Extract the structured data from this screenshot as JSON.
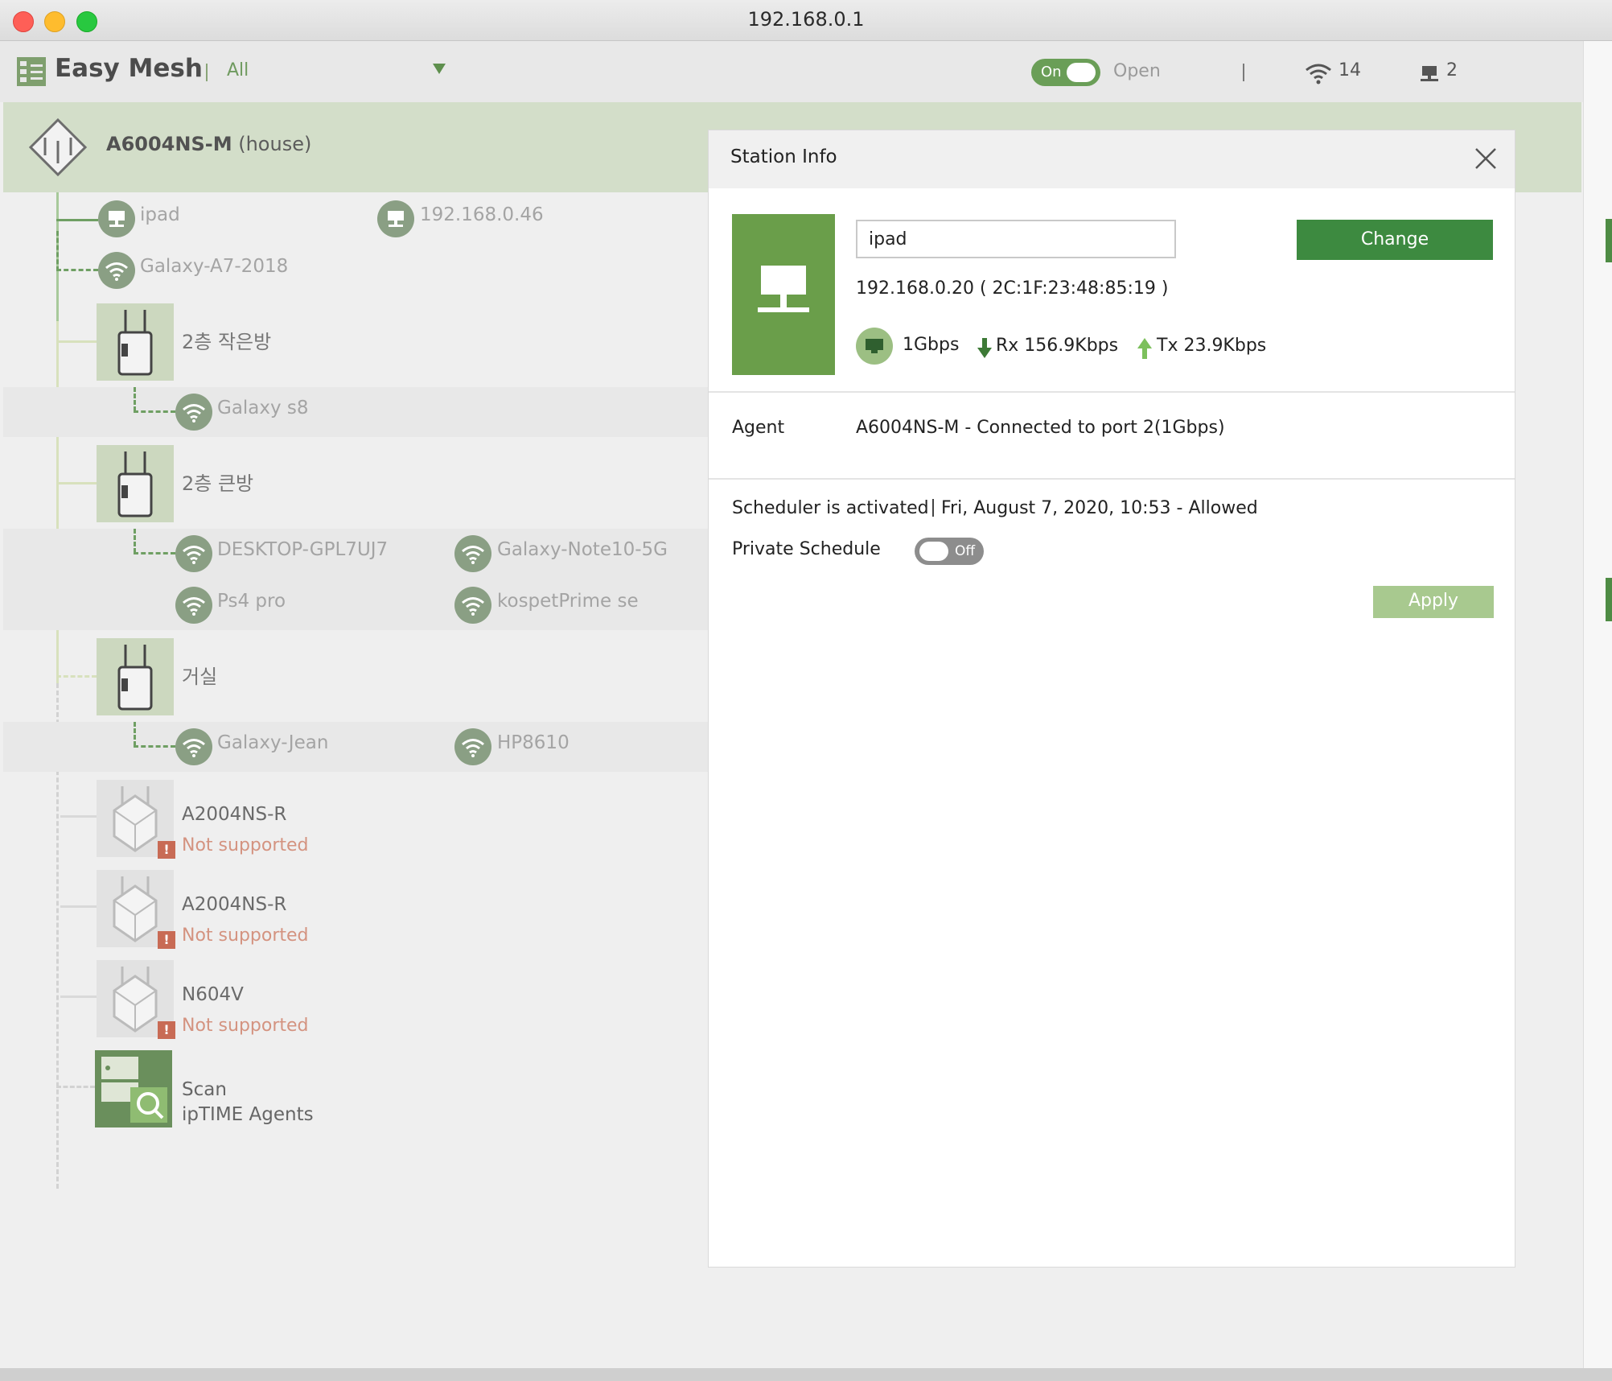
{
  "window": {
    "title": "192.168.0.1"
  },
  "appbar": {
    "app_name": "Easy Mesh",
    "filter": "All",
    "toggle_label": "On",
    "open_label": "Open",
    "wifi_count": "14",
    "wired_count": "2"
  },
  "tree": {
    "root": {
      "name": "A6004NS-M",
      "label": "(house)"
    },
    "root_devices": [
      {
        "name": "ipad",
        "kind": "wired"
      },
      {
        "name": "192.168.0.46",
        "kind": "wired"
      },
      {
        "name": "Galaxy-A7-2018",
        "kind": "wifi"
      }
    ],
    "extenders": [
      {
        "name": "2층 작은방",
        "devices": [
          "Galaxy s8"
        ]
      },
      {
        "name": "2층 큰방",
        "devices": [
          "DESKTOP-GPL7UJ7",
          "Galaxy-Note10-5G",
          "Ps4 pro",
          "kospetPrime se"
        ]
      },
      {
        "name": "거실",
        "devices": [
          "Galaxy-Jean",
          "HP8610"
        ]
      }
    ],
    "unsupported": [
      {
        "name": "A2004NS-R",
        "status": "Not supported"
      },
      {
        "name": "A2004NS-R",
        "status": "Not supported"
      },
      {
        "name": "N604V",
        "status": "Not supported"
      }
    ],
    "scan": {
      "line1": "Scan",
      "line2": "ipTIME Agents"
    }
  },
  "station_info": {
    "title": "Station Info",
    "name_value": "ipad",
    "change_label": "Change",
    "ip_mac": "192.168.0.20 ( 2C:1F:23:48:85:19 )",
    "link_speed": "1Gbps",
    "rx": "Rx 156.9Kbps",
    "tx": "Tx 23.9Kbps",
    "agent_label": "Agent",
    "agent_value": "A6004NS-M - Connected to port 2(1Gbps)",
    "scheduler_label": "Scheduler is activated",
    "scheduler_value": "Fri, August 7, 2020, 10:53 - Allowed",
    "private_schedule_label": "Private Schedule",
    "private_schedule_toggle": "Off",
    "apply_label": "Apply"
  },
  "colors": {
    "accent": "#3d8a40",
    "tree_highlight": "#d3dec9",
    "warning": "#c86b55"
  }
}
